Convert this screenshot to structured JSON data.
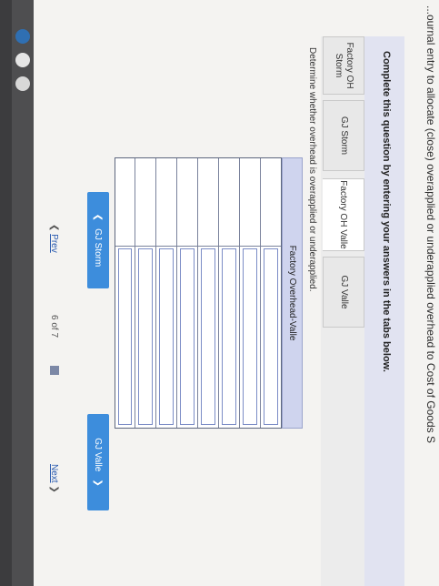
{
  "header": {
    "top_text": "...ournal entry to allocate (close) overapplied or underapplied overhead to Cost of Goods S"
  },
  "instructions": "Complete this question by entering your answers in the tabs below.",
  "tabs": [
    {
      "label": "Factory OH Storm",
      "active": false
    },
    {
      "label": "GJ Storm",
      "active": false
    },
    {
      "label": "Factory OH Valle",
      "active": true
    },
    {
      "label": "GJ Valle",
      "active": false
    }
  ],
  "subtitle": "Determine whether overhead is overapplied or underapplied.",
  "table": {
    "header": "Factory Overhead-Valle",
    "row_count": 8
  },
  "nav": {
    "prev_tab_label": "GJ Storm",
    "next_tab_label": "GJ Valle"
  },
  "pager": {
    "prev_label": "Prev",
    "current": "6",
    "of_label": "of",
    "total": "7",
    "next_label": "Next"
  },
  "colors": {
    "accent": "#3d8ddc",
    "table_header": "#cfd4ee",
    "instruction_bg": "#e1e3f1"
  }
}
